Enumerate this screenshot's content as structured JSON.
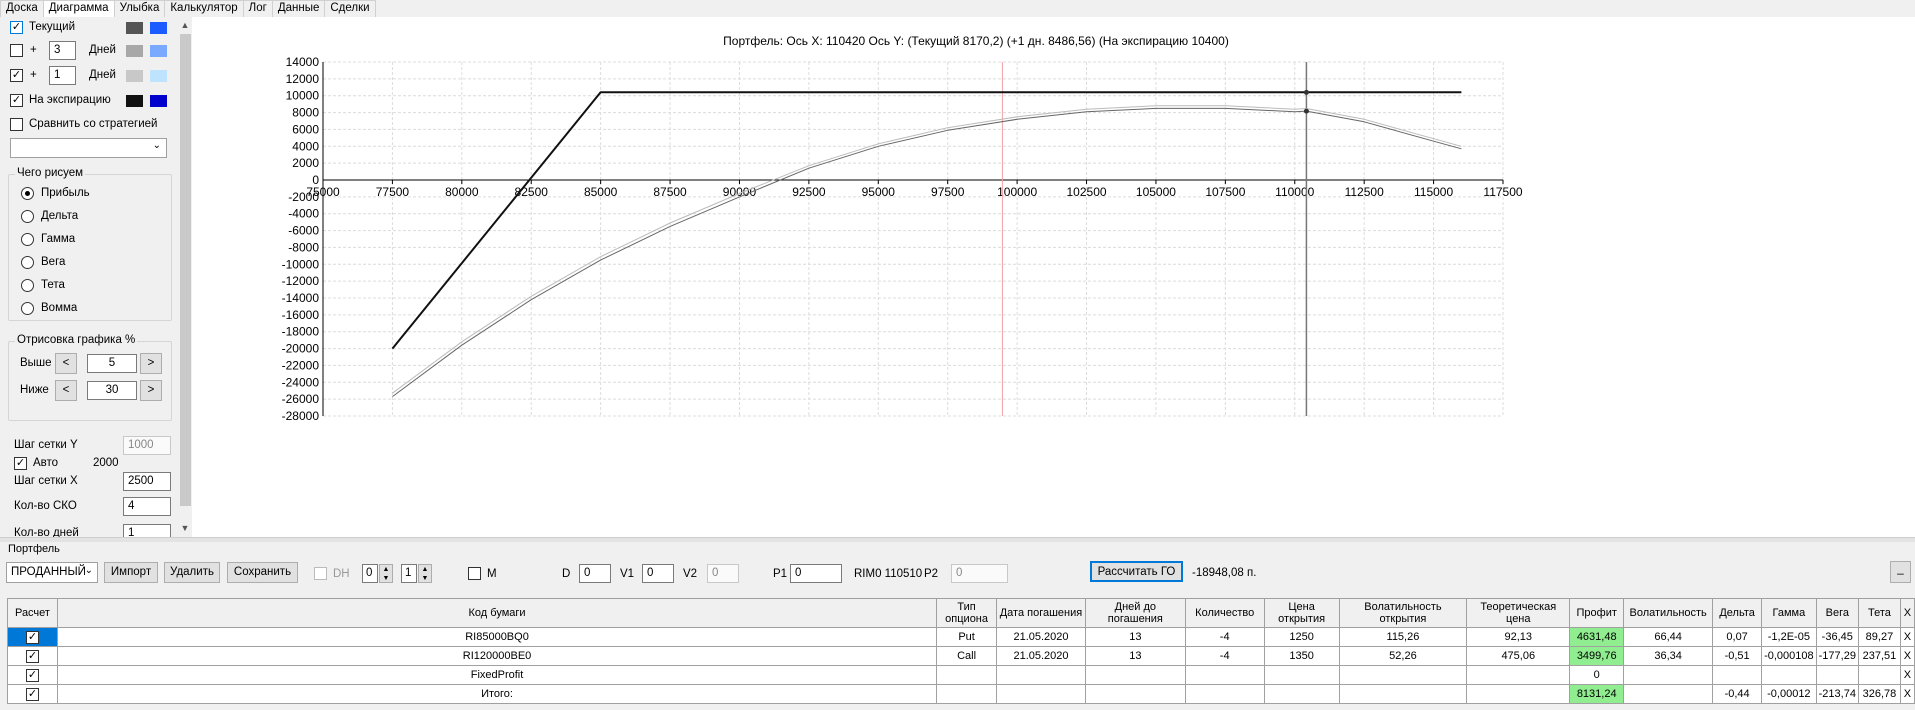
{
  "tabs": [
    {
      "label": "Доска"
    },
    {
      "label": "Диаграмма"
    },
    {
      "label": "Улыбка"
    },
    {
      "label": "Калькулятор"
    },
    {
      "label": "Лог"
    },
    {
      "label": "Данные"
    },
    {
      "label": "Сделки"
    }
  ],
  "left": {
    "current_label": "Текущий",
    "days_label": "Дней",
    "plus": "+",
    "days1": "3",
    "days2": "1",
    "expiry_label": "На экспирацию",
    "compare_label": "Сравнить со стратегией",
    "what_title": "Чего рисуем",
    "radios": [
      {
        "label": "Прибыль"
      },
      {
        "label": "Дельта"
      },
      {
        "label": "Гамма"
      },
      {
        "label": "Вега"
      },
      {
        "label": "Тета"
      },
      {
        "label": "Вомма"
      }
    ],
    "render_title": "Отрисовка графика %",
    "above_label": "Выше",
    "above_value": "5",
    "below_label": "Ниже",
    "below_value": "30",
    "prev": "<",
    "next": ">",
    "grid_y_label": "Шаг сетки Y",
    "grid_y_value": "1000",
    "auto_label": "Авто",
    "auto_value": "2000",
    "grid_x_label": "Шаг сетки X",
    "grid_x_value": "2500",
    "sko_label": "Кол-во СКО",
    "sko_value": "4",
    "ndays_label": "Кол-во дней",
    "ndays_value": "1",
    "colors": {
      "cur_a": "#555555",
      "cur_b": "#1a5cff",
      "d1_a": "#a8a8a8",
      "d1_b": "#7aaaff",
      "d2_a": "#c8c8c8",
      "d2_b": "#bde3ff",
      "exp_a": "#111111",
      "exp_b": "#0000cc"
    }
  },
  "chart_data": {
    "type": "line",
    "title": "Портфель: Ось X: 110420 Ось Y:  (Текущий 8170,2)  (+1 дн. 8486,56)  (На экспирацию 10400)",
    "xlim": [
      75000,
      117500
    ],
    "ylim": [
      -28000,
      14000
    ],
    "x_ticks": [
      75000,
      77500,
      80000,
      82500,
      85000,
      87500,
      90000,
      92500,
      95000,
      97500,
      100000,
      102500,
      105000,
      107500,
      110000,
      112500,
      115000,
      117500
    ],
    "y_ticks": [
      14000,
      12000,
      10000,
      8000,
      6000,
      4000,
      2000,
      0,
      -2000,
      -4000,
      -6000,
      -8000,
      -10000,
      -12000,
      -14000,
      -16000,
      -18000,
      -20000,
      -22000,
      -24000,
      -26000,
      -28000
    ],
    "grid": true,
    "cursor_x": 110420,
    "current_x": 99470,
    "series": [
      {
        "color": "#111111",
        "width": 2,
        "points": [
          [
            77500,
            -20000
          ],
          [
            85000,
            10400
          ],
          [
            116000,
            10400
          ]
        ]
      },
      {
        "color": "#666666",
        "width": 1,
        "points": [
          [
            77500,
            -25700
          ],
          [
            80000,
            -19600
          ],
          [
            82500,
            -14200
          ],
          [
            85000,
            -9500
          ],
          [
            87500,
            -5500
          ],
          [
            90000,
            -2000
          ],
          [
            92500,
            1400
          ],
          [
            95000,
            4000
          ],
          [
            97500,
            5900
          ],
          [
            100000,
            7200
          ],
          [
            102500,
            8100
          ],
          [
            105000,
            8500
          ],
          [
            107500,
            8500
          ],
          [
            110000,
            8100
          ],
          [
            110420,
            8170
          ],
          [
            112500,
            6900
          ],
          [
            115000,
            4600
          ],
          [
            116000,
            3700
          ]
        ]
      },
      {
        "color": "#bbbbbb",
        "width": 1,
        "points": [
          [
            77500,
            -25300
          ],
          [
            80000,
            -19200
          ],
          [
            82500,
            -13800
          ],
          [
            85000,
            -9100
          ],
          [
            87500,
            -5100
          ],
          [
            90000,
            -1600
          ],
          [
            92500,
            1700
          ],
          [
            95000,
            4300
          ],
          [
            97500,
            6200
          ],
          [
            100000,
            7500
          ],
          [
            102500,
            8400
          ],
          [
            105000,
            8800
          ],
          [
            107500,
            8800
          ],
          [
            110000,
            8400
          ],
          [
            110420,
            8486
          ],
          [
            112500,
            7200
          ],
          [
            115000,
            4900
          ],
          [
            116000,
            4000
          ]
        ]
      }
    ],
    "markers": [
      {
        "x": 110420,
        "y": 10400
      },
      {
        "x": 110420,
        "y": 8170
      }
    ]
  },
  "bottom": {
    "title": "Портфель",
    "combo": "ПРОДАННЫЙ",
    "import": "Импорт",
    "delete": "Удалить",
    "save": "Сохранить",
    "dh": "DH",
    "spin1": "0",
    "spin2": "1",
    "m": "M",
    "d_label": "D",
    "d_value": "0",
    "v1_label": "V1",
    "v1_value": "0",
    "v2_label": "V2",
    "v2_value": "0",
    "p1_label": "P1",
    "p1_value": "0",
    "rim_text": "RIM0 110510",
    "p2_label": "P2",
    "p2_value": "0",
    "calc_go": "Рассчитать ГО",
    "go_value": "-18948,08 п.",
    "min_btn": "_"
  },
  "grid": {
    "headers": [
      "Расчет",
      "Код бумаги",
      "Тип опциона",
      "Дата погашения",
      "Дней до погашения",
      "Количество",
      "Цена открытия",
      "Волатильность открытия",
      "Теоретическая цена",
      "Профит",
      "Волатильность",
      "Дельта",
      "Гамма",
      "Вега",
      "Тета",
      "X"
    ],
    "rows": [
      {
        "code": "RI85000BQ0",
        "type": "Put",
        "date": "21.05.2020",
        "days": "13",
        "qty": "-4",
        "price": "1250",
        "vol_open": "115,26",
        "theo": "92,13",
        "profit": "4631,48",
        "vol": "66,44",
        "delta": "0,07",
        "gamma": "-1,2E-05",
        "vega": "-36,45",
        "theta": "89,27",
        "x": "X"
      },
      {
        "code": "RI120000BE0",
        "type": "Call",
        "date": "21.05.2020",
        "days": "13",
        "qty": "-4",
        "price": "1350",
        "vol_open": "52,26",
        "theo": "475,06",
        "profit": "3499,76",
        "vol": "36,34",
        "delta": "-0,51",
        "gamma": "-0,000108",
        "vega": "-177,29",
        "theta": "237,51",
        "x": "X"
      },
      {
        "code": "FixedProfit",
        "type": "",
        "date": "",
        "days": "",
        "qty": "",
        "price": "",
        "vol_open": "",
        "theo": "",
        "profit": "0",
        "vol": "",
        "delta": "",
        "gamma": "",
        "vega": "",
        "theta": "",
        "x": "X"
      },
      {
        "code": "Итого:",
        "type": "",
        "date": "",
        "days": "",
        "qty": "",
        "price": "",
        "vol_open": "",
        "theo": "",
        "profit": "8131,24",
        "vol": "",
        "delta": "-0,44",
        "gamma": "-0,00012",
        "vega": "-213,74",
        "theta": "326,78",
        "x": "X"
      }
    ]
  }
}
